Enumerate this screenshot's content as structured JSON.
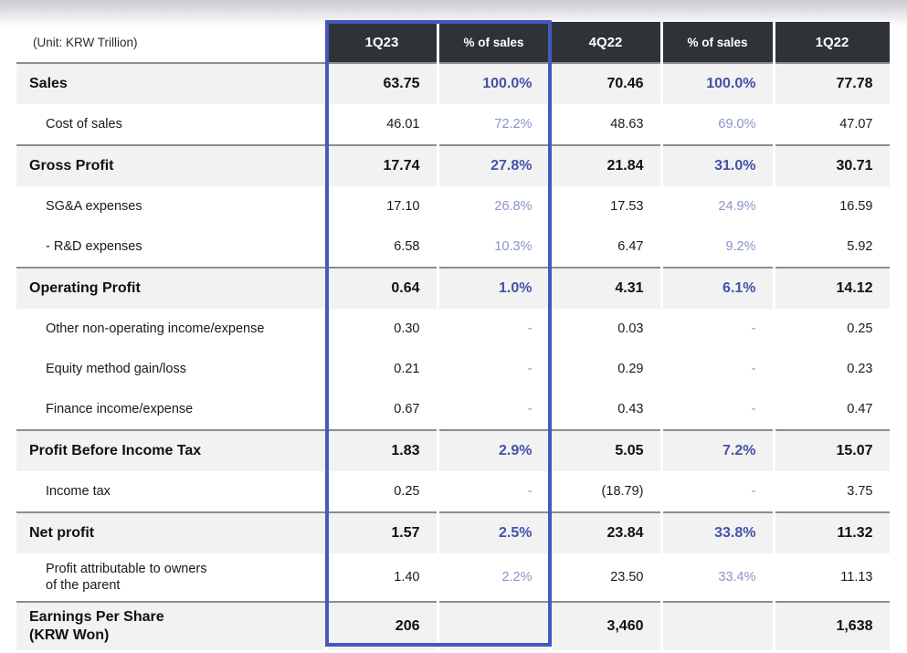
{
  "unit_note": "(Unit: KRW Trillion)",
  "columns": [
    {
      "key": "q1_23",
      "label": "1Q23",
      "type": "value"
    },
    {
      "key": "pct_1",
      "label": "% of sales",
      "type": "percent"
    },
    {
      "key": "q4_22",
      "label": "4Q22",
      "type": "value"
    },
    {
      "key": "pct_2",
      "label": "% of sales",
      "type": "percent"
    },
    {
      "key": "q1_22",
      "label": "1Q22",
      "type": "value"
    }
  ],
  "colors": {
    "header_bg": "#2e3338",
    "highlight_border": "#4458bd",
    "percent_bold": "#4254a8",
    "percent_regular": "#8b94cb",
    "emph_row_bg": "#f2f2f2",
    "emph_row_rule": "#8d8d8d"
  },
  "highlight": {
    "columns": [
      "1Q23",
      "% of sales"
    ],
    "color": "#4458bd"
  },
  "rows": [
    {
      "label": "Sales",
      "label2": "",
      "emph": true,
      "q1_23": "63.75",
      "pct_1": "100.0%",
      "q4_22": "70.46",
      "pct_2": "100.0%",
      "q1_22": "77.78"
    },
    {
      "label": "Cost of sales",
      "label2": "",
      "emph": false,
      "q1_23": "46.01",
      "pct_1": "72.2%",
      "q4_22": "48.63",
      "pct_2": "69.0%",
      "q1_22": "47.07"
    },
    {
      "label": "Gross Profit",
      "label2": "",
      "emph": true,
      "q1_23": "17.74",
      "pct_1": "27.8%",
      "q4_22": "21.84",
      "pct_2": "31.0%",
      "q1_22": "30.71"
    },
    {
      "label": "SG&A expenses",
      "label2": "",
      "emph": false,
      "q1_23": "17.10",
      "pct_1": "26.8%",
      "q4_22": "17.53",
      "pct_2": "24.9%",
      "q1_22": "16.59"
    },
    {
      "label": "- R&D expenses",
      "label2": "",
      "emph": false,
      "q1_23": "6.58",
      "pct_1": "10.3%",
      "q4_22": "6.47",
      "pct_2": "9.2%",
      "q1_22": "5.92"
    },
    {
      "label": "Operating Profit",
      "label2": "",
      "emph": true,
      "q1_23": "0.64",
      "pct_1": "1.0%",
      "q4_22": "4.31",
      "pct_2": "6.1%",
      "q1_22": "14.12"
    },
    {
      "label": "Other non-operating income/expense",
      "label2": "",
      "emph": false,
      "q1_23": "0.30",
      "pct_1": "-",
      "q4_22": "0.03",
      "pct_2": "-",
      "q1_22": "0.25"
    },
    {
      "label": "Equity method gain/loss",
      "label2": "",
      "emph": false,
      "q1_23": "0.21",
      "pct_1": "-",
      "q4_22": "0.29",
      "pct_2": "-",
      "q1_22": "0.23"
    },
    {
      "label": "Finance income/expense",
      "label2": "",
      "emph": false,
      "q1_23": "0.67",
      "pct_1": "-",
      "q4_22": "0.43",
      "pct_2": "-",
      "q1_22": "0.47"
    },
    {
      "label": "Profit Before Income Tax",
      "label2": "",
      "emph": true,
      "q1_23": "1.83",
      "pct_1": "2.9%",
      "q4_22": "5.05",
      "pct_2": "7.2%",
      "q1_22": "15.07"
    },
    {
      "label": "Income tax",
      "label2": "",
      "emph": false,
      "q1_23": "0.25",
      "pct_1": "-",
      "q4_22": "(18.79)",
      "pct_2": "-",
      "q1_22": "3.75"
    },
    {
      "label": "Net profit",
      "label2": "",
      "emph": true,
      "q1_23": "1.57",
      "pct_1": "2.5%",
      "q4_22": "23.84",
      "pct_2": "33.8%",
      "q1_22": "11.32"
    },
    {
      "label": "Profit attributable to owners",
      "label2": "of the parent",
      "emph": false,
      "q1_23": "1.40",
      "pct_1": "2.2%",
      "q4_22": "23.50",
      "pct_2": "33.4%",
      "q1_22": "11.13"
    },
    {
      "label": "Earnings Per Share",
      "label2": "(KRW Won)",
      "emph": true,
      "q1_23": "206",
      "pct_1": "",
      "q4_22": "3,460",
      "pct_2": "",
      "q1_22": "1,638"
    }
  ]
}
